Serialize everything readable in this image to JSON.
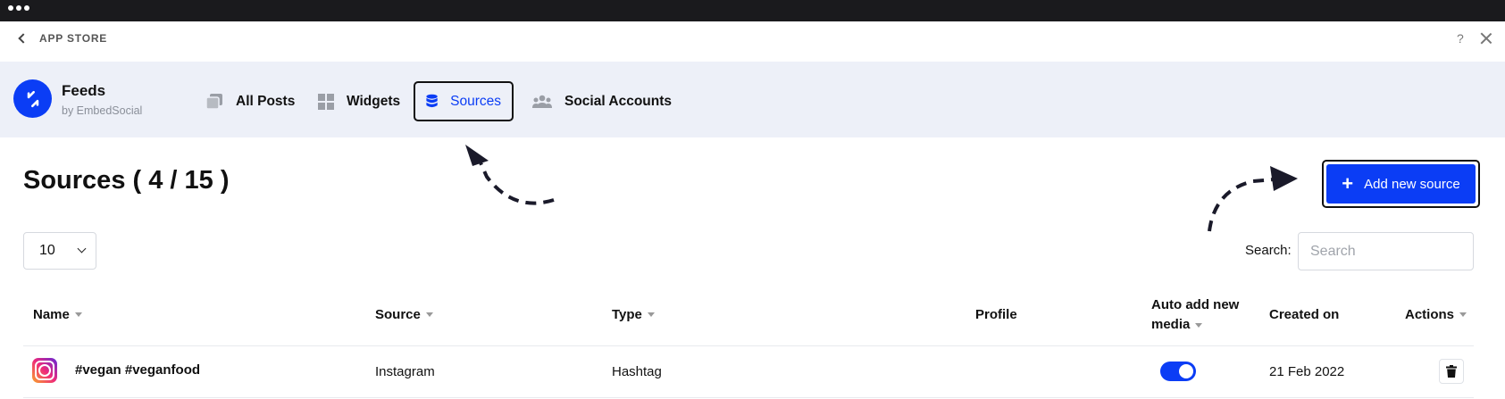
{
  "app_bar": {
    "back_label": "APP STORE",
    "help_label": "?"
  },
  "header": {
    "brand_title": "Feeds",
    "brand_subtitle": "by EmbedSocial",
    "tabs": [
      {
        "label": "All Posts",
        "icon": "stack-icon"
      },
      {
        "label": "Widgets",
        "icon": "grid-icon"
      },
      {
        "label": "Sources",
        "icon": "database-icon",
        "active": true
      },
      {
        "label": "Social Accounts",
        "icon": "users-icon"
      }
    ]
  },
  "main": {
    "title": "Sources ( 4 / 15 )",
    "add_button_label": "Add new source",
    "per_page_value": "10",
    "search_label": "Search:",
    "search_placeholder": "Search"
  },
  "table": {
    "columns": [
      "Name",
      "Source",
      "Type",
      "Profile",
      "Auto add new",
      "media",
      "Created on",
      "Actions"
    ],
    "rows": [
      {
        "name": "#vegan #veganfood",
        "source": "Instagram",
        "type": "Hashtag",
        "profile": "",
        "auto_add": true,
        "created_on": "21 Feb 2022"
      }
    ]
  },
  "colors": {
    "accent": "#0b3df5",
    "header_bg": "#edf0f8",
    "topbar": "#1a1a1d"
  }
}
